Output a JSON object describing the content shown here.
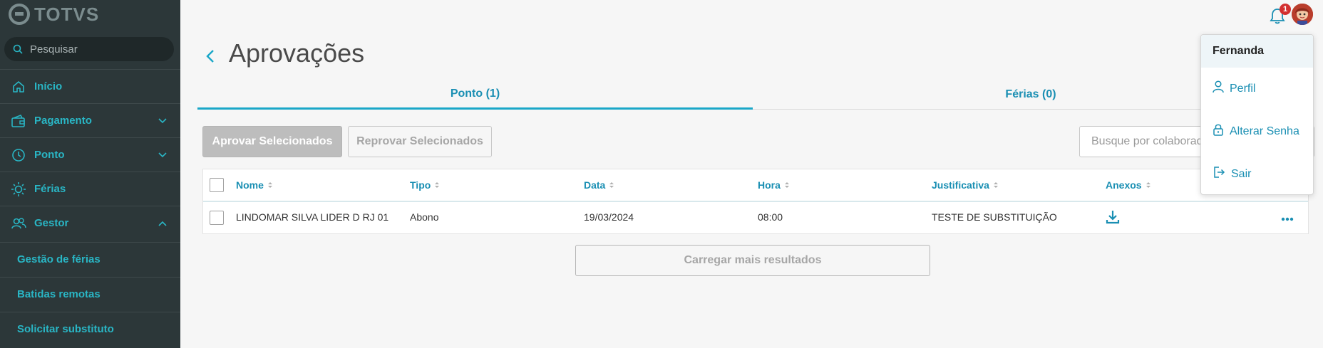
{
  "app": {
    "logo_text": "TOTVS"
  },
  "sidebar": {
    "search_placeholder": "Pesquisar",
    "items": [
      {
        "label": "Início",
        "icon": "home-icon"
      },
      {
        "label": "Pagamento",
        "icon": "wallet-icon",
        "expandable": true
      },
      {
        "label": "Ponto",
        "icon": "clock-icon",
        "expandable": true
      },
      {
        "label": "Férias",
        "icon": "sun-icon"
      },
      {
        "label": "Gestor",
        "icon": "users-icon",
        "expanded": true
      }
    ],
    "subitems": [
      {
        "label": "Gestão de férias"
      },
      {
        "label": "Batidas remotas"
      },
      {
        "label": "Solicitar substituto"
      }
    ]
  },
  "page": {
    "title": "Aprovações"
  },
  "tabs": [
    {
      "label": "Ponto (1)",
      "active": true
    },
    {
      "label": "Férias (0)",
      "active": false
    }
  ],
  "actions": {
    "approve_label": "Aprovar Selecionados",
    "reject_label": "Reprovar Selecionados",
    "search_placeholder": "Busque por colaborador"
  },
  "table": {
    "columns": [
      "Nome",
      "Tipo",
      "Data",
      "Hora",
      "Justificativa",
      "Anexos"
    ],
    "rows": [
      {
        "nome": "LINDOMAR SILVA LIDER D RJ 01",
        "tipo": "Abono",
        "data": "19/03/2024",
        "hora": "08:00",
        "justificativa": "TESTE DE SUBSTITUIÇÃO",
        "anexos_icon": "download-icon"
      }
    ]
  },
  "load_more_label": "Carregar mais resultados",
  "notifications": {
    "count": "1"
  },
  "user_menu": {
    "user_name": "Fernanda",
    "items": [
      {
        "label": "Perfil",
        "icon": "user-icon"
      },
      {
        "label": "Alterar Senha",
        "icon": "lock-icon"
      },
      {
        "label": "Sair",
        "icon": "logout-icon"
      }
    ]
  },
  "colors": {
    "accent": "#29b6c5",
    "link": "#1a8fb3",
    "sidebar_bg": "#2c3739"
  }
}
